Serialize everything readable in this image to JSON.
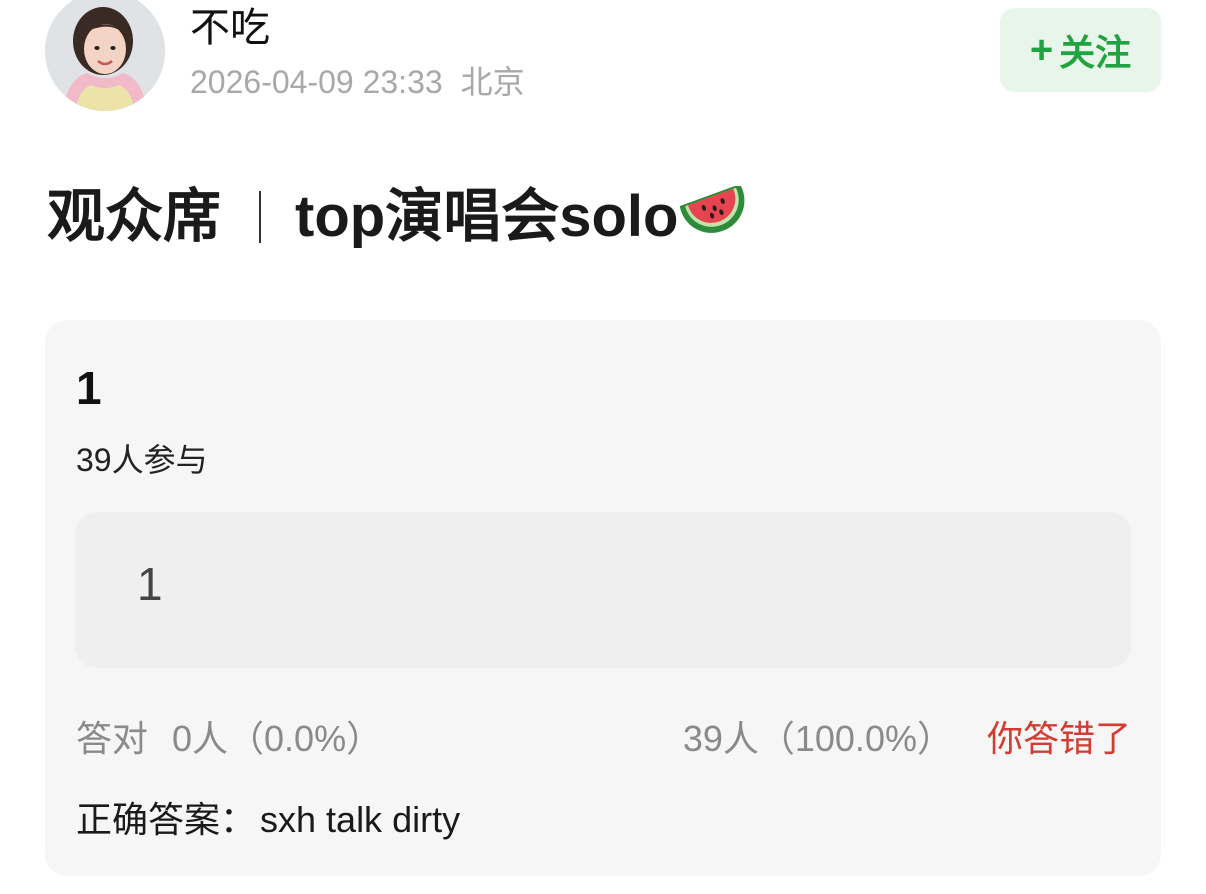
{
  "post": {
    "username": "不吃",
    "date": "2026-04-09 23:33",
    "location": "北京",
    "follow_label": "关注",
    "title_left": "观众席",
    "title_right": "top演唱会solo"
  },
  "quiz": {
    "number": "1",
    "participants": "39人参与",
    "option_label": "1",
    "correct_label": "答对",
    "correct_value": "0人（0.0%）",
    "wrong_value": "39人（100.0%）",
    "result_text": "你答错了",
    "answer_label": "正确答案：",
    "answer_value": "sxh talk dirty"
  },
  "colors": {
    "follow_text": "#22a341",
    "follow_bg": "#e7f5ea",
    "wrong_result": "#d23c32",
    "muted_text": "#8a8a8a"
  },
  "icons": {
    "follow": "plus-icon",
    "title_emoji": "watermelon-icon"
  }
}
